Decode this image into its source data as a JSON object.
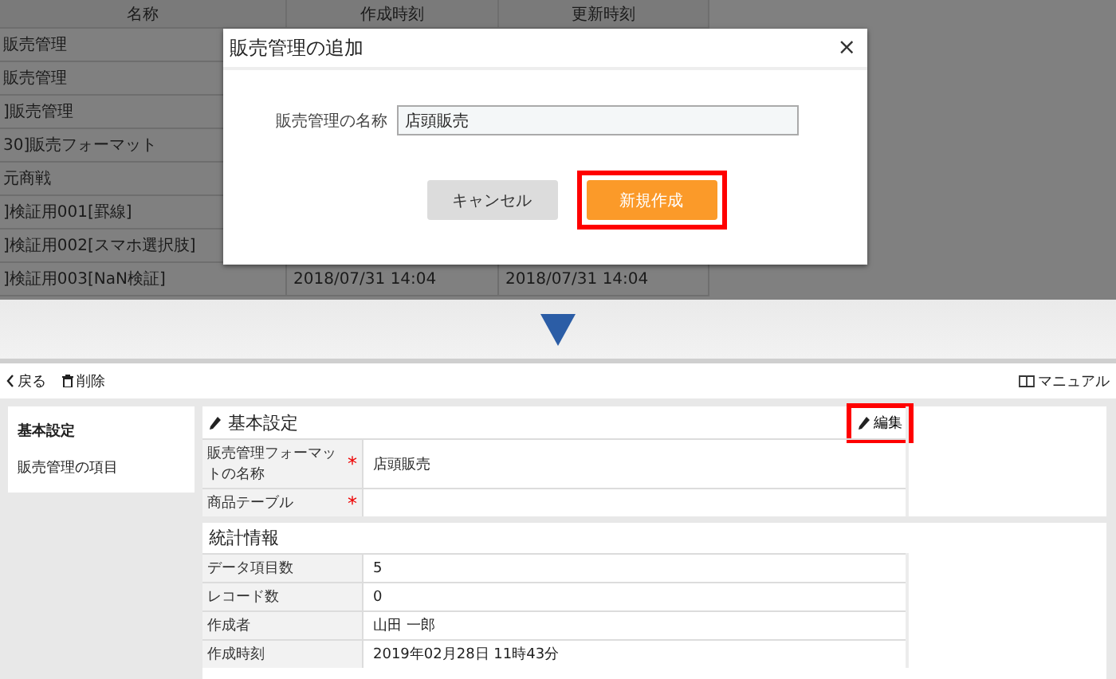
{
  "background_table": {
    "columns": [
      "名称",
      "作成時刻",
      "更新時刻"
    ],
    "rows": [
      {
        "name": "販売管理"
      },
      {
        "name": "販売管理"
      },
      {
        "name": "]販売管理"
      },
      {
        "name": "30]販売フォーマット"
      },
      {
        "name": "元商戦"
      },
      {
        "name": "]検証用001[罫線]"
      },
      {
        "name": "]検証用002[スマホ選択肢]"
      },
      {
        "name": "]検証用003[NaN検証]",
        "created": "2018/07/31 14:04",
        "updated": "2018/07/31 14:04"
      }
    ]
  },
  "dialog": {
    "title": "販売管理の追加",
    "close": "×",
    "field_label": "販売管理の名称",
    "field_value": "店頭販売",
    "buttons": [
      {
        "label": "キャンセル",
        "kind": "secondary",
        "highlighted": false
      },
      {
        "label": "新規作成",
        "kind": "primary",
        "highlighted": true
      }
    ]
  },
  "detail": {
    "toolbar": {
      "back": "戻る",
      "delete": "削除",
      "manual": "マニュアル"
    },
    "sidebar": [
      {
        "label": "基本設定",
        "selected": true
      },
      {
        "label": "販売管理の項目",
        "selected": false
      }
    ],
    "basic": {
      "title": "基本設定",
      "edit_button": {
        "label": "編集",
        "highlighted": true
      },
      "rows": [
        {
          "label": "販売管理フォーマットの名称",
          "required_mark": "*",
          "value": "店頭販売"
        },
        {
          "label": "商品テーブル",
          "required_mark": "*"
        }
      ]
    },
    "stats": {
      "title": "統計情報",
      "rows": [
        {
          "label": "データ項目数",
          "value": "5"
        },
        {
          "label": "レコード数",
          "value": "0"
        },
        {
          "label": "作成者",
          "value": "山田 一郎"
        },
        {
          "label": "作成時刻",
          "value": "2019年02月28日 11時43分"
        }
      ]
    }
  }
}
